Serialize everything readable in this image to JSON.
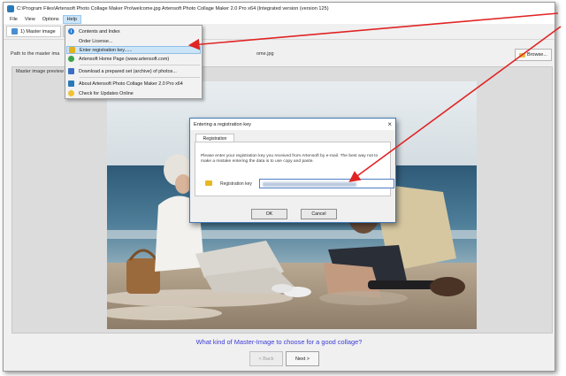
{
  "window": {
    "title": "C:\\Program Files\\Artensoft Photo Collage Maker Pro\\welcome.jpg Artensoft Photo Collage Maker 2.0 Pro x64 (Integrated version (version 125)"
  },
  "menubar": {
    "items": [
      {
        "label": "File"
      },
      {
        "label": "View"
      },
      {
        "label": "Options"
      },
      {
        "label": "Help"
      }
    ]
  },
  "toolbar": {
    "step_label": "1) Master image"
  },
  "path": {
    "label": "Path to the master ima",
    "file": "ome.jpg"
  },
  "browse_label": "Browse...",
  "preview": {
    "label": "Master image preview"
  },
  "help_menu": {
    "items": [
      {
        "label": "Contents and Index",
        "icon": "info-icon"
      },
      {
        "label": "Order License..."
      },
      {
        "label": "Enter registration key......",
        "icon": "key-icon"
      },
      {
        "label": "Artensoft Home Page (www.artensoft.com)",
        "icon": "globe-icon"
      },
      {
        "label": "Download a prepared set (archive) of photos...",
        "icon": "download-icon"
      },
      {
        "label": "About Artensoft Photo Collage Maker 2.0 Pro x64",
        "icon": "about-icon"
      },
      {
        "label": "Check for Updates Online",
        "icon": "bulb-icon"
      }
    ]
  },
  "dialog": {
    "title": "Entering a registration key",
    "tab_label": "Registration",
    "info_text": "Please enter your registration key you received from Artensoft by e-mail. The best way not to make a mistake entering the data is to use copy and paste.",
    "key_label": "Registration key",
    "ok_label": "OK",
    "cancel_label": "Cancel"
  },
  "question_link": "What kind of Master-Image to choose for a good collage?",
  "nav": {
    "back_label": "< Back",
    "next_label": "Next >"
  },
  "colors": {
    "annotation_arrow": "#e02424",
    "link": "#3b3bd6",
    "menu_highlight": "#cce4f7",
    "dialog_border": "#3d77b6"
  }
}
